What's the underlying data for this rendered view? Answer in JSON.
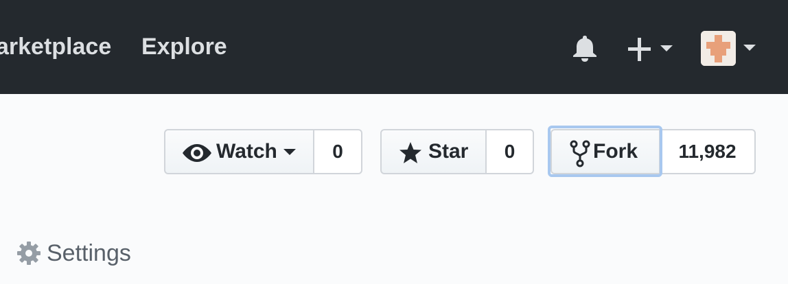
{
  "header": {
    "nav": [
      {
        "label": "arketplace"
      },
      {
        "label": "Explore"
      }
    ],
    "icons": {
      "notifications": "bell-icon",
      "create": "plus-icon",
      "avatar": "identicon-avatar"
    }
  },
  "actions": {
    "watch": {
      "label": "Watch",
      "count": "0",
      "icon": "eye-icon"
    },
    "star": {
      "label": "Star",
      "count": "0",
      "icon": "star-icon"
    },
    "fork": {
      "label": "Fork",
      "count": "11,982",
      "icon": "fork-icon"
    }
  },
  "tabs": {
    "settings": {
      "label": "Settings",
      "icon": "gear-icon"
    }
  },
  "colors": {
    "header_bg": "#24292e",
    "page_bg": "#fafbfc",
    "focus": "#a8c8ef",
    "avatar_accent": "#e8a07a"
  }
}
